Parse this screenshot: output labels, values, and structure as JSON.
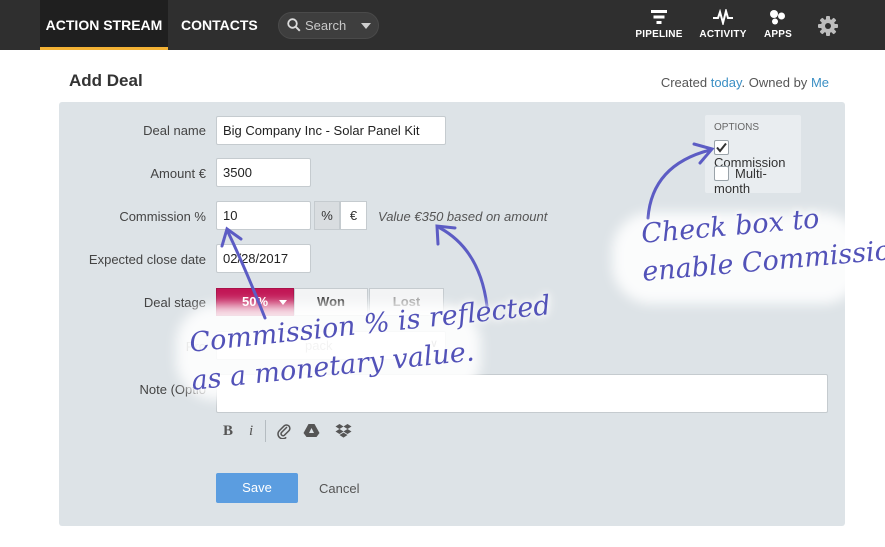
{
  "nav": {
    "tabs": [
      {
        "label": "ACTION STREAM",
        "active": true
      },
      {
        "label": "CONTACTS",
        "active": false
      }
    ],
    "search_placeholder": "Search",
    "icons": [
      {
        "label": "PIPELINE",
        "icon": "pipeline-icon"
      },
      {
        "label": "ACTIVITY",
        "icon": "activity-icon"
      },
      {
        "label": "APPS",
        "icon": "apps-icon"
      }
    ],
    "settings_icon": "gear-icon"
  },
  "header": {
    "title": "Add Deal",
    "created_prefix": "Created",
    "created_link": "today",
    "owned_prefix": ". Owned by",
    "owner_link": "Me"
  },
  "form": {
    "deal_name_label": "Deal name",
    "deal_name_value": "Big Company Inc - Solar Panel Kit",
    "amount_label": "Amount €",
    "amount_value": "3500",
    "commission_label": "Commission %",
    "commission_value": "10",
    "commission_unit_percent": "%",
    "commission_unit_euro": "€",
    "commission_hint": "Value €350 based on amount",
    "close_date_label": "Expected close date",
    "close_date_value": "02/28/2017",
    "stage_label": "Deal stage",
    "stage_options": [
      {
        "label": "50%",
        "selected": true
      },
      {
        "label": "Won",
        "selected": false
      },
      {
        "label": "Lost",
        "selected": false
      }
    ],
    "product_label": "Pro",
    "product_value": "pack",
    "note_label": "Note (Optio",
    "save_label": "Save",
    "cancel_label": "Cancel"
  },
  "options": {
    "header": "OPTIONS",
    "items": [
      {
        "label": "Commission",
        "checked": true
      },
      {
        "label": "Multi-month",
        "checked": false
      }
    ]
  },
  "annotations": {
    "right_line1": "Check box to",
    "right_line2": "enable Commission.",
    "left_line1": "Commission % is reflected",
    "left_line2": "as a monetary value."
  },
  "colors": {
    "accent": "#f2b134",
    "stage_selected": "#c21655",
    "save_button": "#5b9de0",
    "annotation": "#5252b8",
    "link": "#3b8fc4"
  }
}
